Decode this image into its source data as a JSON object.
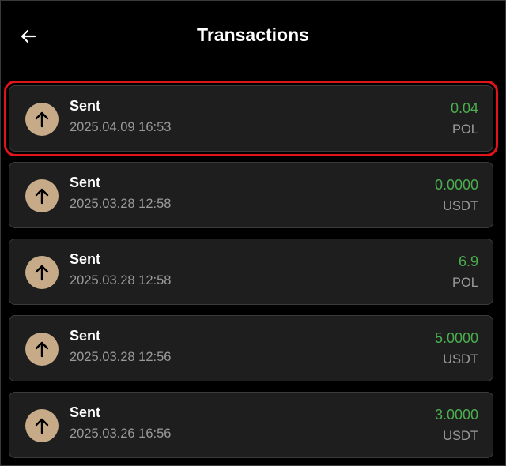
{
  "header": {
    "back_icon": "arrow-left-icon",
    "title": "Transactions"
  },
  "transactions": [
    {
      "type": "Sent",
      "date": "2025.04.09 16:53",
      "amount": "0.04",
      "unit": "POL",
      "icon": "arrow-up-icon",
      "highlighted": true
    },
    {
      "type": "Sent",
      "date": "2025.03.28 12:58",
      "amount": "0.0000",
      "unit": "USDT",
      "icon": "arrow-up-icon",
      "highlighted": false
    },
    {
      "type": "Sent",
      "date": "2025.03.28 12:58",
      "amount": "6.9",
      "unit": "POL",
      "icon": "arrow-up-icon",
      "highlighted": false
    },
    {
      "type": "Sent",
      "date": "2025.03.28 12:56",
      "amount": "5.0000",
      "unit": "USDT",
      "icon": "arrow-up-icon",
      "highlighted": false
    },
    {
      "type": "Sent",
      "date": "2025.03.26 16:56",
      "amount": "3.0000",
      "unit": "USDT",
      "icon": "arrow-up-icon",
      "highlighted": false
    }
  ],
  "colors": {
    "background": "#000000",
    "card": "#1e1e1e",
    "amount": "#4caf50",
    "icon_circle": "#c7ab88",
    "highlight": "#e0141b"
  }
}
